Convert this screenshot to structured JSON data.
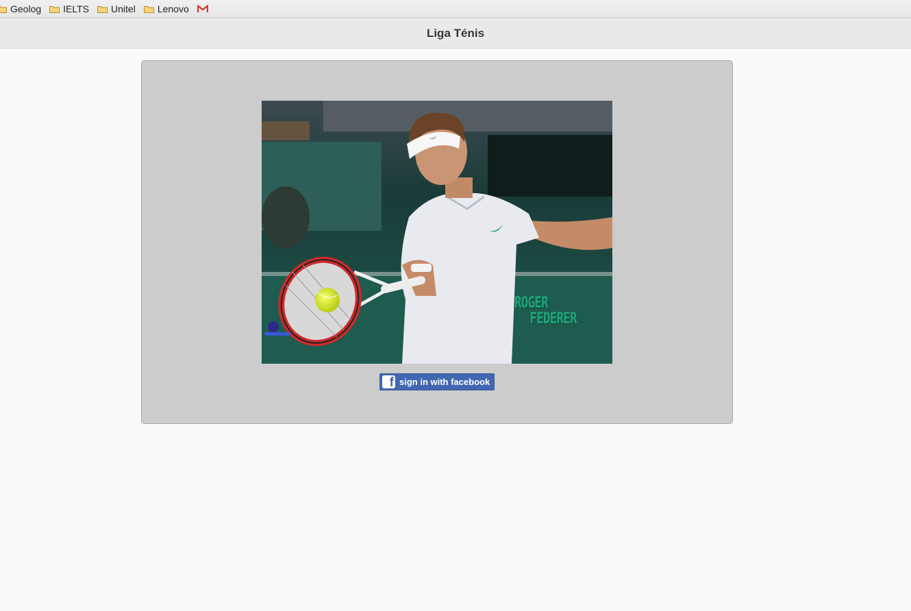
{
  "bookmarks": [
    {
      "label": "Geolog",
      "icon": "folder-icon"
    },
    {
      "label": "IELTS",
      "icon": "folder-icon"
    },
    {
      "label": "Unitel",
      "icon": "folder-icon"
    },
    {
      "label": "Lenovo",
      "icon": "folder-icon"
    }
  ],
  "gmail_bookmark": {
    "icon": "gmail-icon",
    "color": "#d93025"
  },
  "header": {
    "title": "Liga Ténis"
  },
  "hero_image": {
    "watermark_line1": "ROGER",
    "watermark_line2": "FEDERER"
  },
  "login": {
    "facebook_label": "sign in with facebook",
    "facebook_icon": "f",
    "facebook_color": "#4267b2"
  },
  "colors": {
    "page_bg": "#f9f9f9",
    "panel_bg": "#cccccc",
    "header_bg": "#e9e9e9"
  }
}
